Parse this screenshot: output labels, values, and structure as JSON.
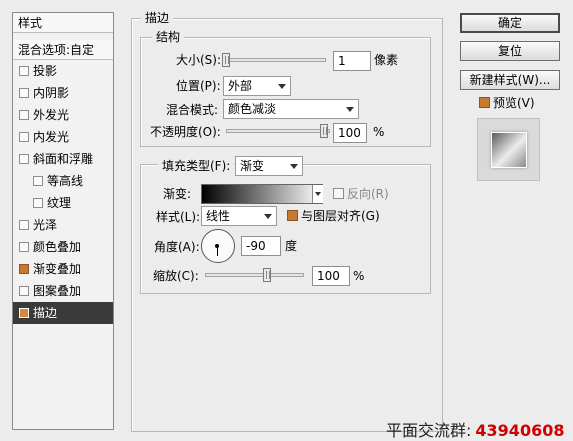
{
  "style_list": {
    "header": "样式",
    "blend_options": "混合选项:自定",
    "items": [
      {
        "label": "投影",
        "checked": false
      },
      {
        "label": "内阴影",
        "checked": false
      },
      {
        "label": "外发光",
        "checked": false
      },
      {
        "label": "内发光",
        "checked": false
      },
      {
        "label": "斜面和浮雕",
        "checked": false
      },
      {
        "label": "等高线",
        "checked": false
      },
      {
        "label": "纹理",
        "checked": false
      },
      {
        "label": "光泽",
        "checked": false
      },
      {
        "label": "颜色叠加",
        "checked": false
      },
      {
        "label": "渐变叠加",
        "checked": true
      },
      {
        "label": "图案叠加",
        "checked": false
      },
      {
        "label": "描边",
        "checked": true,
        "selected": true
      }
    ]
  },
  "stroke": {
    "title": "描边",
    "structure_title": "结构",
    "size_label": "大小(S):",
    "size_value": "1",
    "size_unit": "像素",
    "position_label": "位置(P):",
    "position_value": "外部",
    "blend_label": "混合模式:",
    "blend_value": "颜色减淡",
    "opacity_label": "不透明度(O):",
    "opacity_value": "100",
    "opacity_unit": "%",
    "fill_type_label": "填充类型(F):",
    "fill_type_value": "渐变",
    "gradient_label": "渐变:",
    "reverse_label": "反向(R)",
    "style_label": "样式(L):",
    "style_value": "线性",
    "align_label": "与图层对齐(G)",
    "angle_label": "角度(A):",
    "angle_value": "-90",
    "angle_unit": "度",
    "scale_label": "缩放(C):",
    "scale_value": "100",
    "scale_unit": "%"
  },
  "buttons": {
    "ok": "确定",
    "reset": "复位",
    "new_style": "新建样式(W)...",
    "preview": "预览(V)"
  },
  "watermark": {
    "label": "平面交流群:",
    "number": "43940608"
  },
  "colors": {
    "accent": "#c87a30",
    "watermark_number": "#d00000",
    "selected_bg": "#3a3a3a"
  }
}
